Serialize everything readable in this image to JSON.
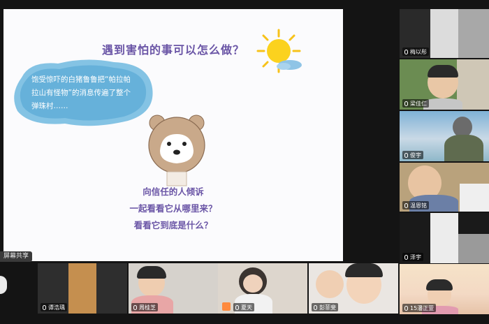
{
  "slide": {
    "title": "遇到害怕的事可以怎么做？",
    "story": "饱受惊吓的白猪鲁鲁把“帕拉帕拉山有怪物”的消息传遍了整个弹珠村……",
    "lines": [
      "向信任的人倾诉",
      "一起看看它从哪里来？",
      "看看它到底是什么？"
    ]
  },
  "screen_share_label": "屏幕共享",
  "participants_right": [
    {
      "name": "梅以彤"
    },
    {
      "name": "梁佳仁"
    },
    {
      "name": "俊宇"
    },
    {
      "name": "温恩铭"
    },
    {
      "name": "泽宇"
    },
    {
      "name": "15潘正萱"
    }
  ],
  "participants_bottom": [
    {
      "name": "谭浩瑀"
    },
    {
      "name": "周桂芝"
    },
    {
      "name": "夏天"
    },
    {
      "name": "彭菲斐"
    }
  ]
}
